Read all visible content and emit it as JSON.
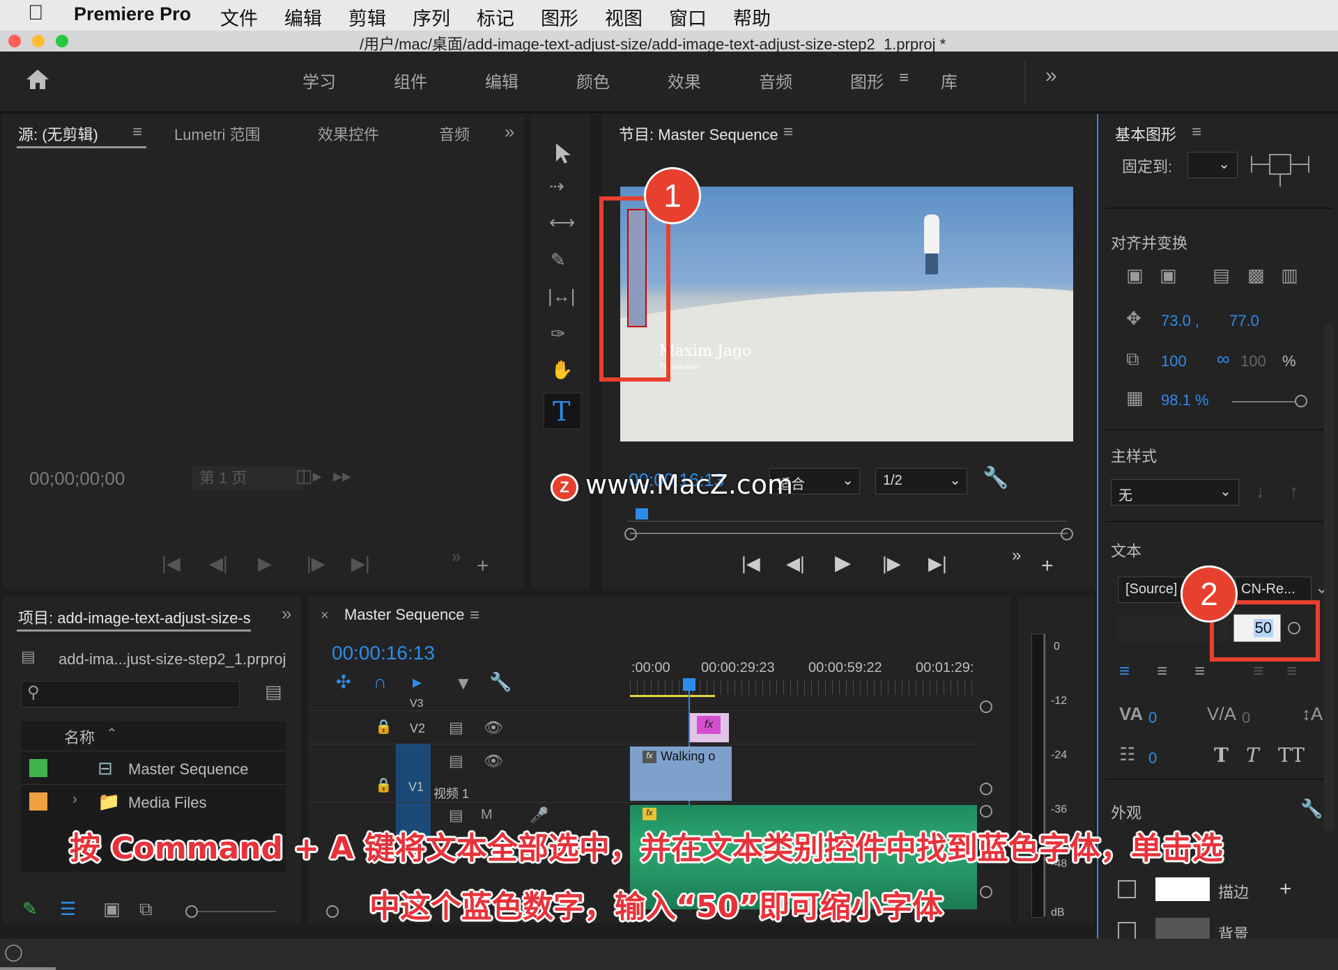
{
  "menubar": {
    "app_name": "Premiere Pro",
    "items": [
      "文件",
      "编辑",
      "剪辑",
      "序列",
      "标记",
      "图形",
      "视图",
      "窗口",
      "帮助"
    ]
  },
  "titlebar": {
    "path": "/用户/mac/桌面/add-image-text-adjust-size/add-image-text-adjust-size-step2_1.prproj *"
  },
  "workspaces": {
    "items": [
      "学习",
      "组件",
      "编辑",
      "颜色",
      "效果",
      "音频",
      "图形",
      "库"
    ],
    "active": "图形",
    "more": "»"
  },
  "source_panel": {
    "tabs": [
      "源: (无剪辑)",
      "Lumetri 范围",
      "效果控件",
      "音频"
    ],
    "timecode": "00;00;00;00",
    "page": "第 1 页"
  },
  "program_panel": {
    "title": "节目: Master Sequence",
    "timecode": "00:00:16:13",
    "fit": "适合",
    "resolution": "1/2",
    "overlay_title": "Maxim Jago",
    "overlay_sub": "Travelogue",
    "watermark": "www.MacZ.com",
    "watermark_logo": "Z"
  },
  "project_panel": {
    "title": "项目: add-image-text-adjust-size-s",
    "file": "add-ima...just-size-step2_1.prproj",
    "column_name": "名称",
    "items": [
      {
        "name": "Master Sequence",
        "color": "#3fb44a"
      },
      {
        "name": "Media Files",
        "color": "#f0a040"
      }
    ]
  },
  "timeline": {
    "title": "Master Sequence",
    "timecode": "00:00:16:13",
    "ruler": [
      ":00:00",
      "00:00:29:23",
      "00:00:59:22",
      "00:01:29:"
    ],
    "tracks": [
      "V3",
      "V2",
      "V1"
    ],
    "v1_label": "视频 1",
    "clip_name": "Walking o",
    "fx": "fx"
  },
  "meter": {
    "labels": [
      "0",
      "-12",
      "-24",
      "-36",
      "-48",
      "dB"
    ]
  },
  "essential_graphics": {
    "title": "基本图形",
    "pin_label": "固定到:",
    "align_section": "对齐并变换",
    "pos_x": "73.0 ,",
    "pos_y": "77.0",
    "scale": "100",
    "scale_h": "100",
    "percent": "%",
    "opacity": "98.1 %",
    "master_style_section": "主样式",
    "master_style_value": "无",
    "text_section": "文本",
    "font": "[Source]",
    "font_style": "CN-Re...",
    "font_size": "50",
    "tracking": "0",
    "kerning": "0",
    "leading": "0",
    "appearance_section": "外观",
    "stroke_label": "描边",
    "background_label": "背景"
  },
  "annotations": {
    "badge1": "1",
    "badge2": "2",
    "caption_line1": "按 Command + A 键将文本全部选中，并在文本类别控件中找到蓝色字体，单击选",
    "caption_line2": "中这个蓝色数字，输入“50”即可缩小字体"
  }
}
